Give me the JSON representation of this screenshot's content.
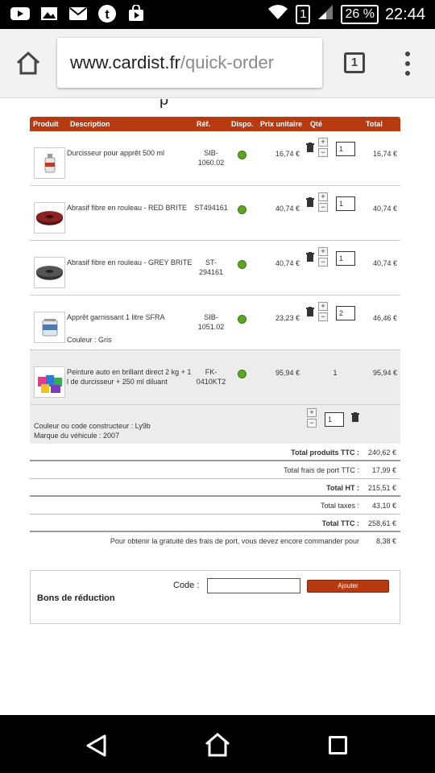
{
  "statusbar": {
    "battery": "26 %",
    "sim": "1",
    "time": "22:44",
    "icons": [
      "youtube-icon",
      "gallery-icon",
      "mail-icon",
      "tumblr-icon",
      "store-icon",
      "wifi-icon",
      "signal-icon"
    ]
  },
  "browser": {
    "url_domain": "www.cardist.fr",
    "url_path": "/quick-order",
    "tab_count": "1"
  },
  "page": {
    "cut_heading_char": "p"
  },
  "table": {
    "headers": {
      "produit": "Produit",
      "description": "Description",
      "ref": "Réf.",
      "dispo": "Dispo.",
      "prix": "Prix unitaire",
      "qte": "Qté",
      "total": "Total"
    },
    "rows": [
      {
        "description": "Durcisseur pour apprêt 500 ml",
        "variant": "",
        "ref": "SIB-1060.02",
        "price": "16,74 €",
        "qty": "1",
        "total": "16,74 €"
      },
      {
        "description": "Abrasif fibre en rouleau - RED BRITE",
        "variant": "",
        "ref": "ST494161",
        "price": "40,74 €",
        "qty": "1",
        "total": "40,74 €"
      },
      {
        "description": "Abrasif fibre en rouleau - GREY BRITE",
        "variant": "",
        "ref": "ST-294161",
        "price": "40,74 €",
        "qty": "1",
        "total": "40,74 €"
      },
      {
        "description": "Apprêt garnissant 1 litre SFRA",
        "variant": "Couleur : Gris",
        "ref": "SIB-1051.02",
        "price": "23,23 €",
        "qty": "2",
        "total": "46,46 €"
      },
      {
        "description": "Peinture auto en brillant direct 2 kg + 1 l de durcisseur + 250 ml diluant",
        "variant": "",
        "ref": "FK-0410KT2",
        "price": "95,94 €",
        "qty": "1",
        "total": "95,94 €"
      }
    ],
    "extra": {
      "line1": "Couleur ou code constructeur : Ly9b",
      "line2": "Marque du véhicule : 2007",
      "qty": "1"
    }
  },
  "totals": {
    "produits_label": "Total produits TTC :",
    "produits_value": "240,62 €",
    "port_label": "Total frais de port TTC :",
    "port_value": "17,99 €",
    "ht_label": "Total HT :",
    "ht_value": "215,51 €",
    "taxes_label": "Total taxes :",
    "taxes_value": "43,10 €",
    "ttc_label": "Total TTC :",
    "ttc_value": "258,61 €",
    "gratuite_label": "Pour obtenir la gratuité des frais de port, vous devez encore commander pour",
    "gratuite_value": "8,38 €"
  },
  "bons": {
    "title": "Bons de réduction",
    "code_label": "Code :",
    "code_value": "",
    "apply_label": "Ajouter"
  },
  "colors": {
    "accent": "#b83a10",
    "available": "#5aa820"
  }
}
